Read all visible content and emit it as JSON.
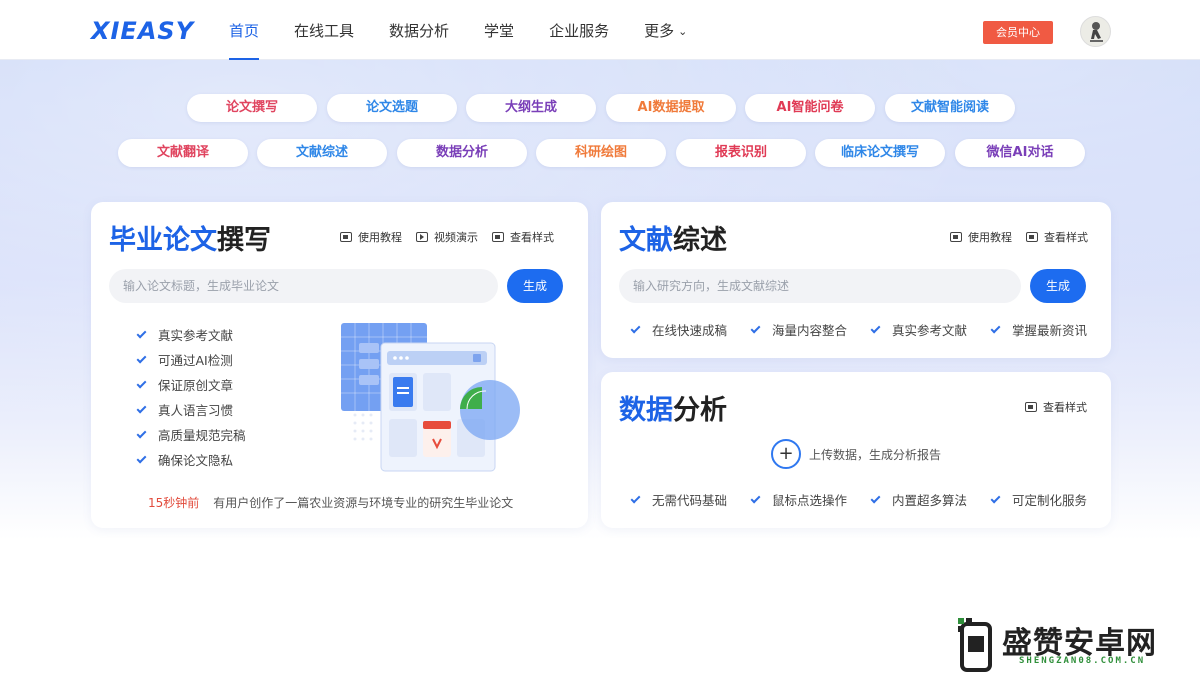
{
  "header": {
    "logo": "XIEASY",
    "nav": [
      {
        "label": "首页",
        "active": true
      },
      {
        "label": "在线工具",
        "active": false
      },
      {
        "label": "数据分析",
        "active": false
      },
      {
        "label": "学堂",
        "active": false
      },
      {
        "label": "企业服务",
        "active": false
      },
      {
        "label": "更多",
        "active": false
      }
    ],
    "more_chevron": "⌄",
    "member_center": "会员中心"
  },
  "tags": {
    "row1": [
      {
        "label": "论文撰写",
        "color": "#e0445f"
      },
      {
        "label": "论文选题",
        "color": "#2f87e8"
      },
      {
        "label": "大纲生成",
        "color": "#7a3fb8"
      },
      {
        "label": "AI数据提取",
        "color": "#f07a3a"
      },
      {
        "label": "AI智能问卷",
        "color": "#e03a55"
      },
      {
        "label": "文献智能阅读",
        "color": "#2f87e8"
      }
    ],
    "row2": [
      {
        "label": "文献翻译",
        "color": "#e0445f"
      },
      {
        "label": "文献综述",
        "color": "#2f87e8"
      },
      {
        "label": "数据分析",
        "color": "#7a3fb8"
      },
      {
        "label": "科研绘图",
        "color": "#f07a3a"
      },
      {
        "label": "报表识别",
        "color": "#e03a55"
      },
      {
        "label": "临床论文撰写",
        "color": "#2f87e8"
      },
      {
        "label": "微信AI对话",
        "color": "#7a3fb8"
      }
    ]
  },
  "thesis": {
    "title_blue": "毕业论文",
    "title_dark": "撰写",
    "links": [
      "使用教程",
      "视频演示",
      "查看样式"
    ],
    "input_placeholder": "输入论文标题，生成毕业论文",
    "button": "生成",
    "features": [
      "真实参考文献",
      "可通过AI检测",
      "保证原创文章",
      "真人语言习惯",
      "高质量规范完稿",
      "确保论文隐私"
    ],
    "recent_time": "15秒钟前",
    "recent_text": "有用户创作了一篇农业资源与环境专业的研究生毕业论文"
  },
  "review": {
    "title_blue": "文献",
    "title_dark": "综述",
    "links": [
      "使用教程",
      "查看样式"
    ],
    "input_placeholder": "输入研究方向，生成文献综述",
    "button": "生成",
    "features": [
      "在线快速成稿",
      "海量内容整合",
      "真实参考文献",
      "掌握最新资讯"
    ]
  },
  "analysis": {
    "title_blue": "数据",
    "title_dark": "分析",
    "links": [
      "查看样式"
    ],
    "upload_text": "上传数据，生成分析报告",
    "features": [
      "无需代码基础",
      "鼠标点选操作",
      "内置超多算法",
      "可定制化服务"
    ]
  },
  "watermark": {
    "title": "盛赞安卓网",
    "subtitle": "SHENGZAN08.COM.CN"
  },
  "colors": {
    "accent": "#1d63e6",
    "member_button": "#f05a43"
  }
}
